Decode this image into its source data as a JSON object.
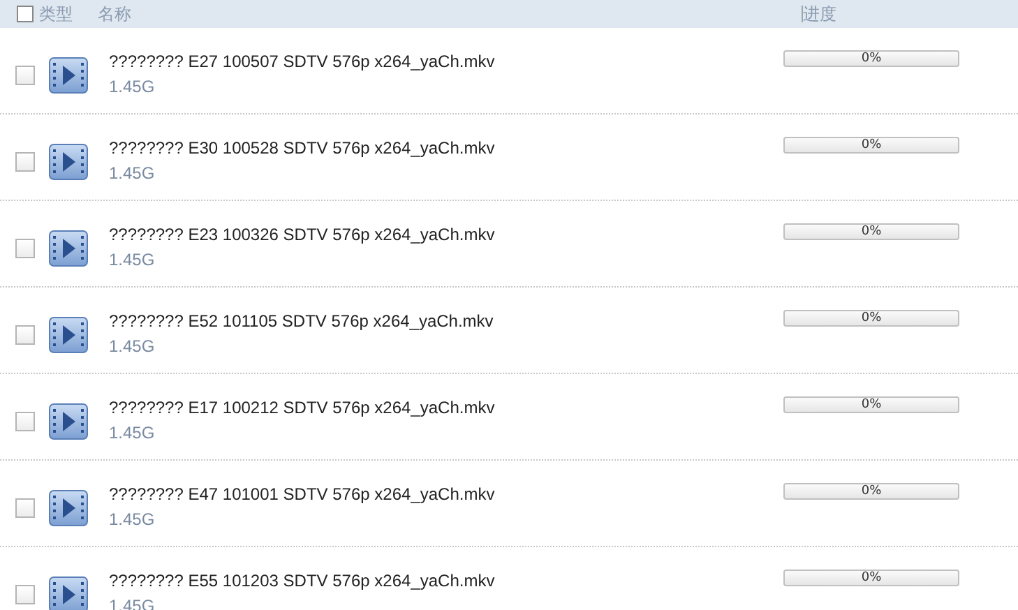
{
  "header": {
    "select_all": {
      "checked": false
    },
    "columns": [
      "类型",
      "名称",
      "进度"
    ]
  },
  "files": [
    {
      "name": "???????? E27 100507 SDTV 576p x264_yaCh.mkv",
      "size": "1.45G",
      "checked": false,
      "level": 0,
      "progress": "0%"
    },
    {
      "name": "???????? E30 100528 SDTV 576p x264_yaCh.mkv",
      "size": "1.45G",
      "checked": false,
      "level": 0,
      "progress": "0%"
    },
    {
      "name": "???????? E23 100326 SDTV 576p x264_yaCh.mkv",
      "size": "1.45G",
      "checked": false,
      "level": 0,
      "progress": "0%"
    },
    {
      "name": "???????? E52 101105 SDTV 576p x264_yaCh.mkv",
      "size": "1.45G",
      "checked": false,
      "level": 0,
      "progress": "0%"
    },
    {
      "name": "???????? E17 100212 SDTV 576p x264_yaCh.mkv",
      "size": "1.45G",
      "checked": false,
      "level": 0,
      "progress": "0%"
    },
    {
      "name": "???????? E47 101001 SDTV 576p x264_yaCh.mkv",
      "size": "1.45G",
      "checked": false,
      "level": 0,
      "progress": "0%"
    },
    {
      "name": "???????? E55 101203 SDTV 576p x264_yaCh.mkv",
      "size": "1.45G",
      "checked": false,
      "level": 0,
      "progress": "0%"
    }
  ]
}
